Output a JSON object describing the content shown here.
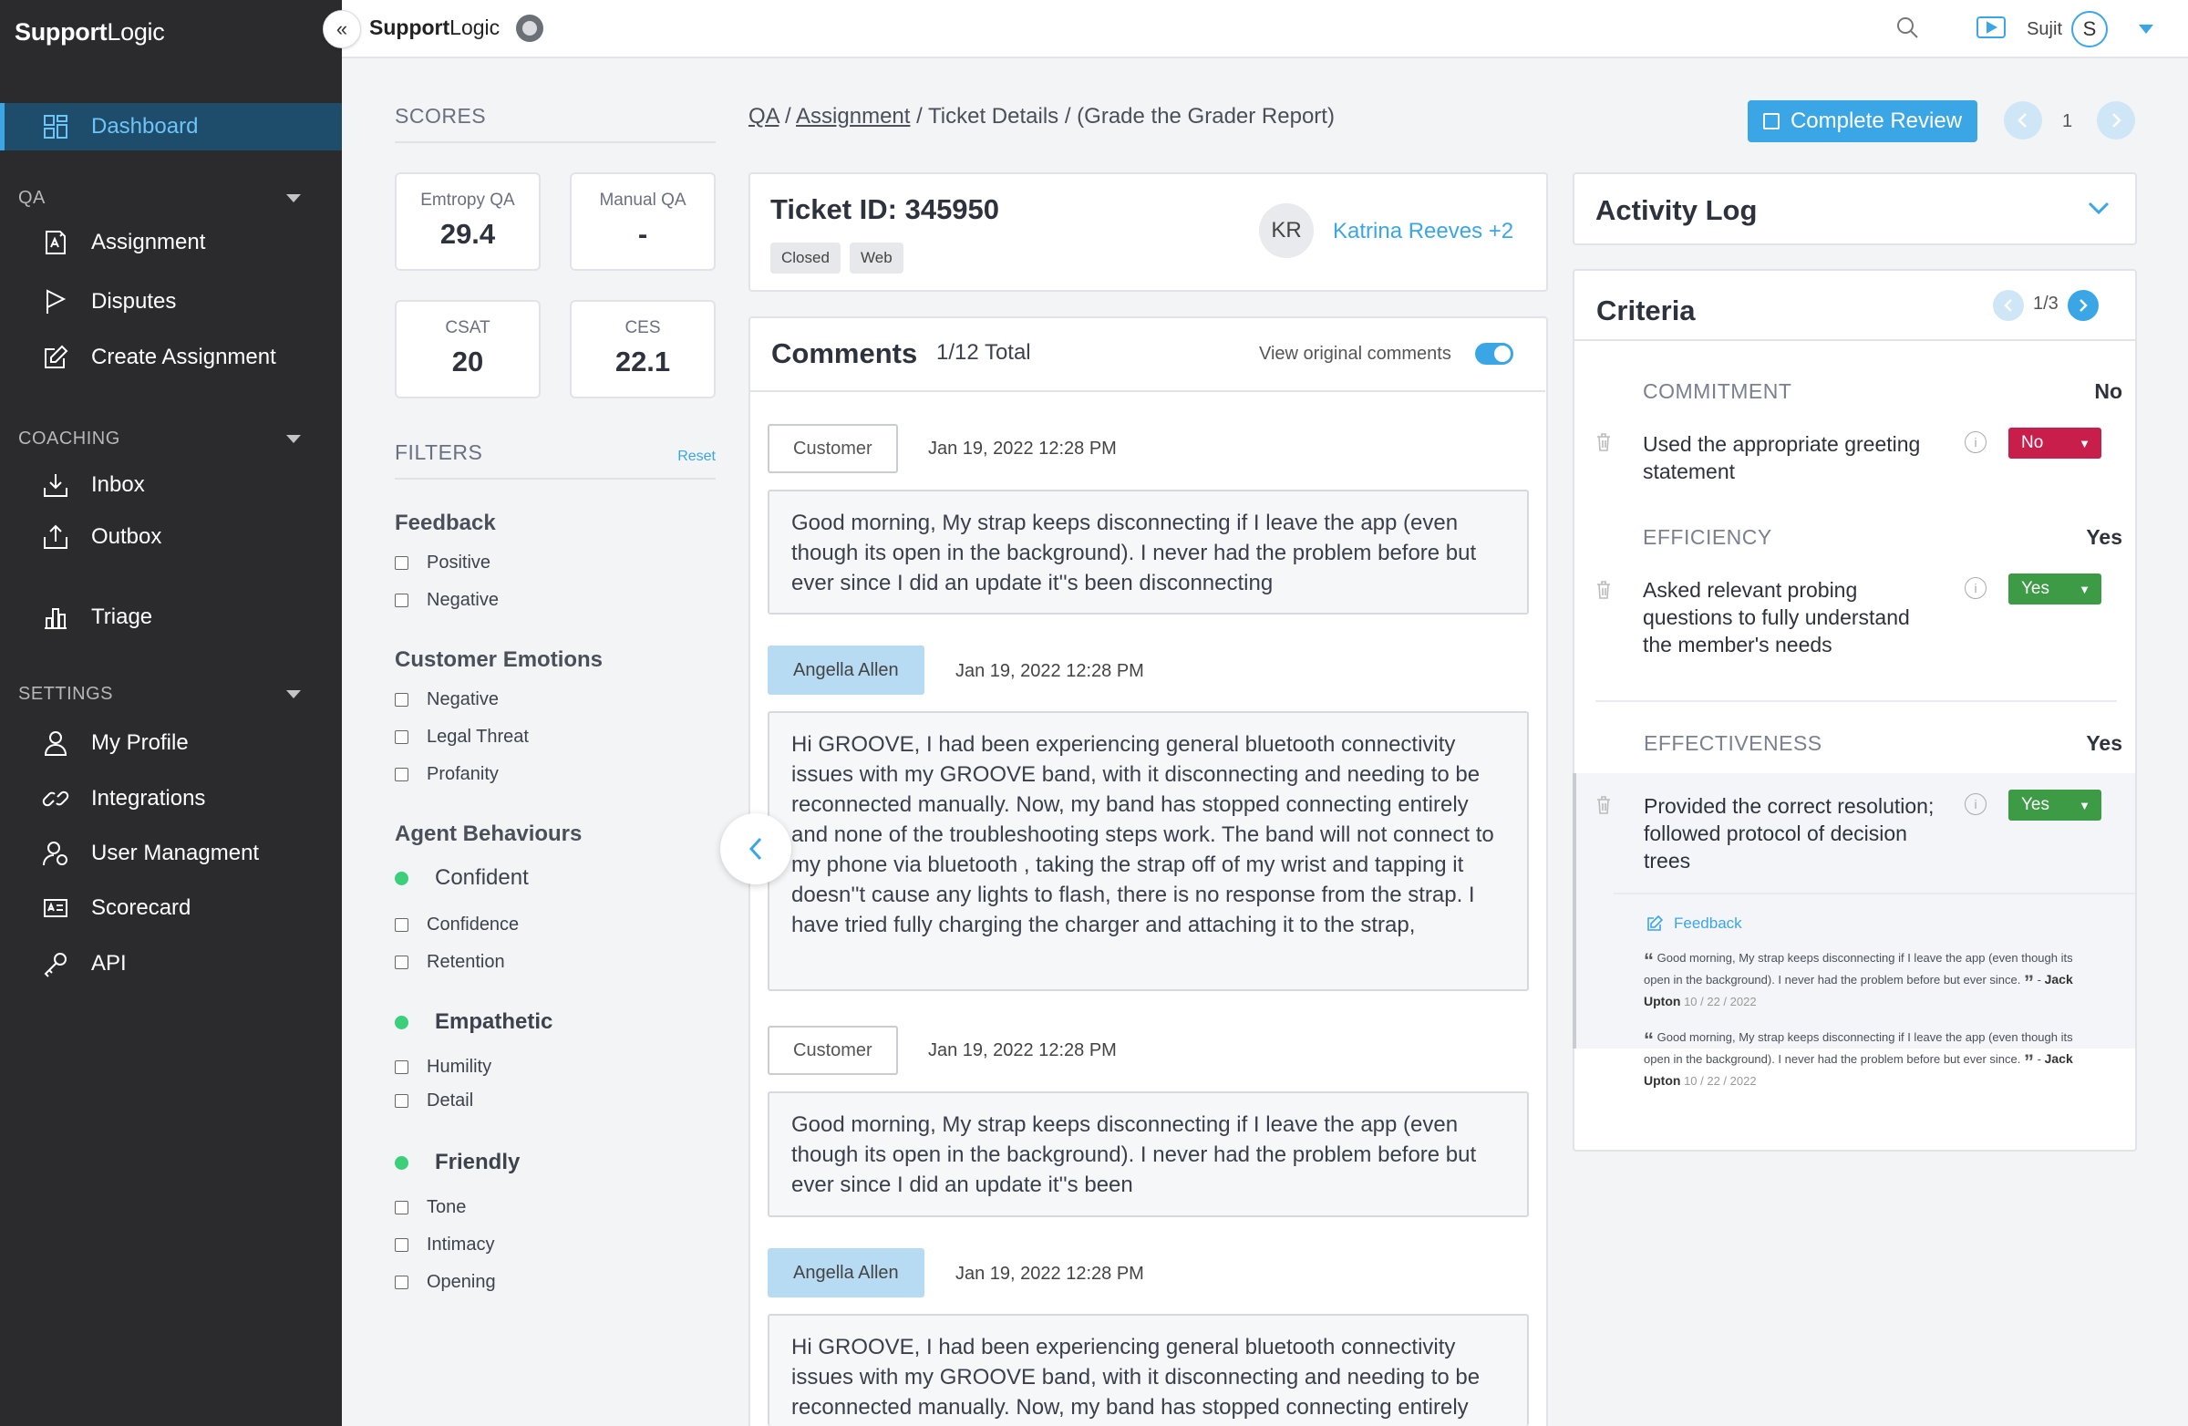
{
  "sidebar": {
    "logo_bold": "Support",
    "logo_light": "Logic",
    "dashboard": "Dashboard",
    "qa_section": "QA",
    "qa_items": [
      "Assignment",
      "Disputes",
      "Create Assignment"
    ],
    "coaching_section": "COACHING",
    "coaching_items": [
      "Inbox",
      "Outbox"
    ],
    "triage": "Triage",
    "settings_section": "SETTINGS",
    "settings_items": [
      "My Profile",
      "Integrations",
      "User Managment",
      "Scorecard",
      "API"
    ]
  },
  "topbar": {
    "logo_bold": "Support",
    "logo_light": "Logic",
    "collapse_glyph": "«",
    "username": "Sujit",
    "avatar_letter": "S"
  },
  "scores": {
    "title": "SCORES",
    "cards": [
      {
        "label": "Emtropy QA",
        "value": "29.4"
      },
      {
        "label": "Manual QA",
        "value": "-"
      },
      {
        "label": "CSAT",
        "value": "20"
      },
      {
        "label": "CES",
        "value": "22.1"
      }
    ]
  },
  "filters": {
    "title": "FILTERS",
    "reset": "Reset",
    "feedback_title": "Feedback",
    "feedback": [
      "Positive",
      "Negative"
    ],
    "emotions_title": "Customer Emotions",
    "emotions": [
      "Negative",
      "Legal Threat",
      "Profanity"
    ],
    "behaviours_title": "Agent Behaviours",
    "confident": "Confident",
    "confident_items": [
      "Confidence",
      "Retention"
    ],
    "empathetic": "Empathetic",
    "empathetic_items": [
      "Humility",
      "Detail"
    ],
    "friendly": "Friendly",
    "friendly_items": [
      "Tone",
      "Intimacy",
      "Opening"
    ]
  },
  "breadcrumb": {
    "qa": "QA",
    "sep": "/",
    "assignment": "Assignment",
    "rest": "/ Ticket Details / (Grade the Grader Report)"
  },
  "review": {
    "complete_label": "Complete Review",
    "page": "1"
  },
  "ticket": {
    "id_label": "Ticket ID: 345950",
    "tags": [
      "Closed",
      "Web"
    ],
    "assignee_initials": "KR",
    "assignee": "Katrina Reeves +2"
  },
  "comments": {
    "title": "Comments",
    "total": "1/12 Total",
    "view_original": "View original comments",
    "items": [
      {
        "author": "Customer",
        "date": "Jan 19, 2022 12:28 PM",
        "text": "Good morning, My strap keeps disconnecting if I leave the app (even though its open in the background). I never had the problem before but ever since I did an update it''s been disconnecting"
      },
      {
        "author": "Angella Allen",
        "date": "Jan 19, 2022 12:28 PM",
        "text": "Hi GROOVE, I had been experiencing general bluetooth connectivity issues with my GROOVE band, with it disconnecting and needing to be reconnected manually. Now, my band has stopped connecting entirely and none of the troubleshooting steps work. The band will not connect to my phone  via bluetooth , taking the strap off of my wrist and tapping it doesn''t cause any lights to flash, there is  no response  from the strap. I have tried fully charging the charger and attaching it to the strap,"
      },
      {
        "author": "Customer",
        "date": "Jan 19, 2022 12:28 PM",
        "text": "Good morning, My strap keeps disconnecting if I leave the app (even though its open in the background). I never had the problem before but ever since I did an update it''s been"
      },
      {
        "author": "Angella Allen",
        "date": "Jan 19, 2022 12:28 PM",
        "text": "Hi GROOVE, I had been experiencing general bluetooth connectivity issues with my GROOVE band, with it disconnecting and needing to be reconnected manually. Now, my band has stopped connecting entirely"
      }
    ]
  },
  "activity": {
    "title": "Activity Log"
  },
  "criteria": {
    "title": "Criteria",
    "page": "1/3",
    "groups": [
      {
        "category": "COMMITMENT",
        "result": "No",
        "item": "Used the appropriate greeting statement",
        "select": "No"
      },
      {
        "category": "EFFICIENCY",
        "result": "Yes",
        "item": "Asked relevant probing questions to fully understand the member's needs",
        "select": "Yes"
      },
      {
        "category": "EFFECTIVENESS",
        "result": "Yes",
        "item": "Provided the correct resolution; followed protocol of decision trees",
        "select": "Yes"
      }
    ],
    "feedback_label": "Feedback",
    "feedback_items": [
      {
        "text": "Good morning, My strap keeps disconnecting if I leave the app (even though its open in the background). I never had the problem before but ever since.",
        "author": "Jack Upton",
        "date": "10 / 22 / 2022",
        "open_quote": "“",
        "close_quote": "”",
        "dash": "-"
      },
      {
        "text": "Good morning, My strap keeps disconnecting if I leave the app (even though its open in the background). I never had the problem before but ever since.",
        "author": "Jack Upton",
        "date": "10 / 22 / 2022",
        "open_quote": "“",
        "close_quote": "”",
        "dash": "-"
      }
    ]
  },
  "colors": {
    "accent": "#3ba6e6",
    "sidebar": "#2b2b2e",
    "no": "#c81e4b",
    "yes": "#3d9a45",
    "behaviour_dot": "#3bcf7a"
  }
}
